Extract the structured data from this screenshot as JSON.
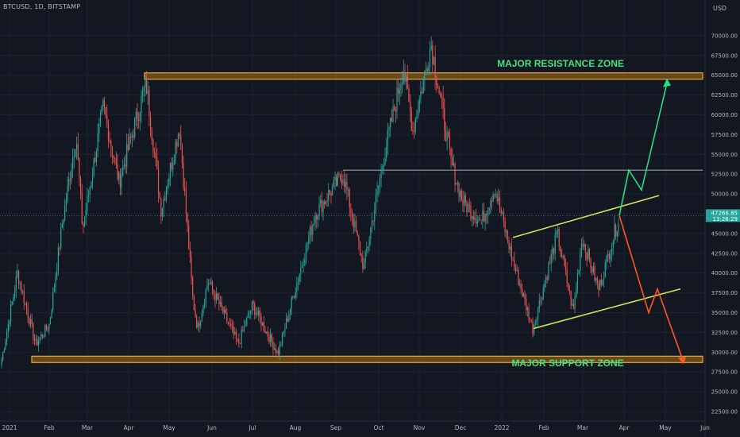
{
  "header": {
    "symbol_line": "BTCUSD, 1D, BITSTAMP",
    "currency": "USD"
  },
  "price_tag": {
    "price": "47266.85",
    "countdown": "13:26:29",
    "color": "#26a69a"
  },
  "colors": {
    "background": "#131722",
    "up": "#26a69a",
    "down": "#ef5350",
    "zone": "#f5a623",
    "channel": "#d4e157",
    "level": "#787b86",
    "bull_arrow": "#26de81",
    "bear_arrow": "#ff5722",
    "annotation": "#4ade80",
    "axis_text": "#b2b5be"
  },
  "chart_data": {
    "type": "candlestick",
    "symbol": "BTCUSD",
    "timeframe": "1D",
    "exchange": "BITSTAMP",
    "y_axis": {
      "ticks": [
        "70000.00",
        "67500.00",
        "65000.00",
        "62500.00",
        "60000.00",
        "57500.00",
        "55000.00",
        "52500.00",
        "50000.00",
        "47500.00",
        "45000.00",
        "42500.00",
        "40000.00",
        "37500.00",
        "35000.00",
        "32500.00",
        "30000.00",
        "27500.00",
        "25000.00",
        "22500.00"
      ],
      "min": 21500,
      "max": 72500
    },
    "x_axis": {
      "labels": [
        "2021",
        "Feb",
        "Mar",
        "Apr",
        "May",
        "Jun",
        "Jul",
        "Aug",
        "Sep",
        "Oct",
        "Nov",
        "Dec",
        "2022",
        "Feb",
        "Mar",
        "Apr",
        "May",
        "Jun"
      ]
    },
    "price_path": [
      [
        "2021",
        29000
      ],
      [
        "Jan-10",
        40000
      ],
      [
        "Jan-22",
        31000
      ],
      [
        "Feb",
        33500
      ],
      [
        "Feb-08",
        46000
      ],
      [
        "Feb-21",
        57500
      ],
      [
        "Feb-28",
        45500
      ],
      [
        "Mar-13",
        61000
      ],
      [
        "Mar-25",
        51500
      ],
      [
        "Apr-13",
        64000
      ],
      [
        "Apr-25",
        48000
      ],
      [
        "May-08",
        58500
      ],
      [
        "May-19",
        36500
      ],
      [
        "May-23",
        33000
      ],
      [
        "Jun-03",
        39000
      ],
      [
        "Jun-22",
        31000
      ],
      [
        "Jul-01",
        36000
      ],
      [
        "Jul-20",
        29800
      ],
      [
        "Aug-14",
        47500
      ],
      [
        "Aug-23",
        50000
      ],
      [
        "Sep-06",
        52500
      ],
      [
        "Sep-21",
        40700
      ],
      [
        "Oct-06",
        55000
      ],
      [
        "Oct-20",
        66000
      ],
      [
        "Oct-28",
        58000
      ],
      [
        "Nov-10",
        69000
      ],
      [
        "Nov-26",
        54000
      ],
      [
        "Dec-04",
        49000
      ],
      [
        "Dec-18",
        46500
      ],
      [
        "Dec-28",
        50800
      ],
      [
        "2022-01-10",
        41500
      ],
      [
        "2022-01-24",
        33000
      ],
      [
        "Feb-10",
        45000
      ],
      [
        "Feb-24",
        35000
      ],
      [
        "Mar-02",
        44500
      ],
      [
        "Mar-15",
        38000
      ],
      [
        "Mar-28",
        47266
      ]
    ],
    "annotations": {
      "resistance_label": "MAJOR RESISTANCE ZONE",
      "support_label": "MAJOR SUPPORT ZONE",
      "resistance_zone": [
        64500,
        65300
      ],
      "support_zone": [
        28700,
        29500
      ],
      "horizontal_level": 53000,
      "channel_upper": [
        [
          44500,
          49800
        ]
      ],
      "channel_lower": [
        [
          33000,
          38000
        ]
      ],
      "bull_scenario": [
        47266,
        53000,
        50500,
        64000
      ],
      "bear_scenario": [
        47266,
        35000,
        38000,
        29000
      ]
    }
  }
}
